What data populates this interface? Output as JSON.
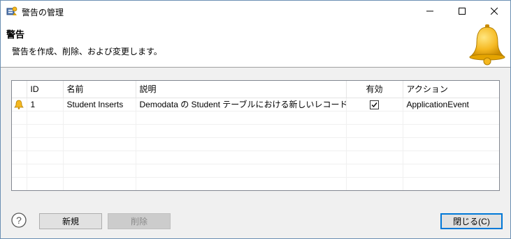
{
  "window": {
    "title": "警告の管理"
  },
  "header": {
    "title": "警告",
    "description": "警告を作成、削除、および変更します。"
  },
  "table": {
    "columns": [
      "ID",
      "名前",
      "説明",
      "有効",
      "アクション"
    ],
    "rows": [
      {
        "icon": "bell-icon",
        "id": "1",
        "name": "Student Inserts",
        "description": "Demodata の Student テーブルにおける新しいレコードの挿入",
        "enabled": true,
        "action": "ApplicationEvent"
      }
    ]
  },
  "buttons": {
    "new": "新規",
    "delete": "削除",
    "close": "閉じる(C)"
  },
  "colors": {
    "accent": "#0078d7",
    "bell": "#f5b820"
  }
}
